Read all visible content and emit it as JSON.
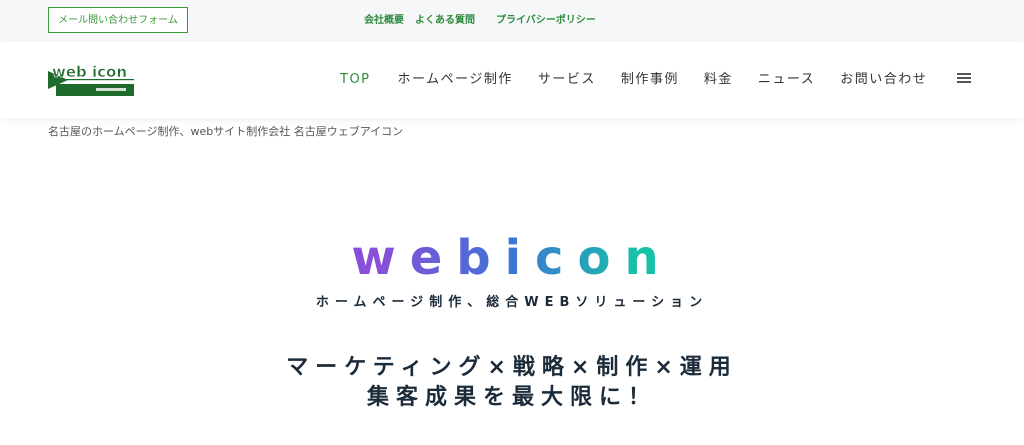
{
  "topbar": {
    "mail_button": "メール問い合わせフォーム",
    "links": [
      "会社概要",
      "よくある質問",
      "プライバシーポリシー"
    ]
  },
  "header": {
    "logo_text": "web icon",
    "nav": [
      "TOP",
      "ホームページ制作",
      "サービス",
      "制作事例",
      "料金",
      "ニュース",
      "お問い合わせ"
    ],
    "active_nav": "TOP",
    "menu_icon": "hamburger-menu-icon"
  },
  "breadcrumb": "名古屋のホームページ制作、webサイト制作会社 名古屋ウェブアイコン",
  "hero": {
    "title": "webicon",
    "subtitle": "ホームページ制作、総合WEBソリューション",
    "tagline_1": "マーケティング×戦略×制作×運用",
    "tagline_2": "集客成果を最大限に！"
  },
  "colors": {
    "accent_green": "#2e8b3e",
    "dark_text": "#1c2b3a",
    "gradient_start": "#8a4fd8",
    "gradient_mid": "#3e73d6",
    "gradient_end": "#17c2a6"
  }
}
